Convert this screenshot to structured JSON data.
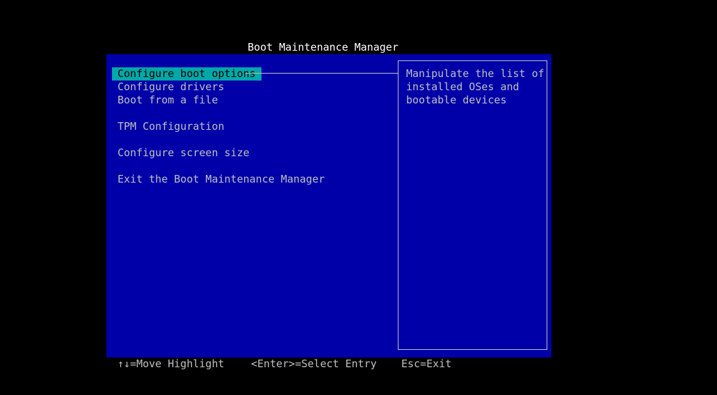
{
  "title": "Boot Maintenance Manager",
  "menu": {
    "items": [
      {
        "label": "Configure boot options",
        "selected": true
      },
      {
        "label": "Configure drivers",
        "selected": false
      },
      {
        "label": "Boot from a file",
        "selected": false
      },
      {
        "label": "TPM Configuration",
        "selected": false
      },
      {
        "label": "Configure screen size",
        "selected": false
      },
      {
        "label": "Exit the Boot Maintenance Manager",
        "selected": false
      }
    ]
  },
  "help": {
    "lines": [
      "Manipulate the list of",
      "installed OSes and",
      "bootable devices"
    ]
  },
  "footer": {
    "move": "↑↓=Move Highlight",
    "select": "<Enter>=Select Entry",
    "exit": "Esc=Exit"
  },
  "colors": {
    "background": "#000000",
    "panel": "#0000a8",
    "highlight": "#00a8a8",
    "text": "#c0c0c0",
    "title": "#ffffff"
  }
}
